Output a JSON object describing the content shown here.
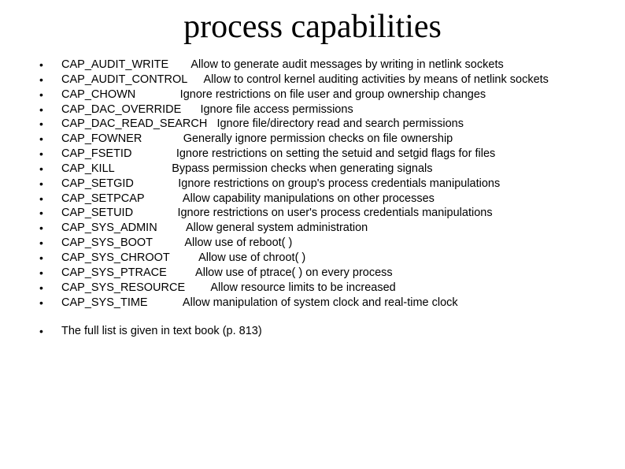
{
  "title": "process capabilities",
  "capabilities": [
    {
      "name": "CAP_AUDIT_WRITE",
      "desc": "Allow to generate audit messages by writing in netlink sockets",
      "sp": "       "
    },
    {
      "name": "CAP_AUDIT_CONTROL",
      "desc": "Allow to control kernel auditing activities by means of netlink sockets",
      "sp": "     "
    },
    {
      "name": "CAP_CHOWN",
      "desc": "Ignore restrictions on file user and group ownership changes",
      "sp": "              "
    },
    {
      "name": "CAP_DAC_OVERRIDE",
      "desc": "Ignore file access permissions",
      "sp": "      "
    },
    {
      "name": "CAP_DAC_READ_SEARCH",
      "desc": "Ignore file/directory read and search permissions",
      "sp": "   "
    },
    {
      "name": "CAP_FOWNER",
      "desc": "Generally ignore permission checks on file ownership",
      "sp": "             "
    },
    {
      "name": "CAP_FSETID",
      "desc": "Ignore restrictions on setting the setuid and setgid flags for files",
      "sp": "              "
    },
    {
      "name": "CAP_KILL",
      "desc": "Bypass permission checks when generating signals",
      "sp": "                  "
    },
    {
      "name": "CAP_SETGID",
      "desc": "Ignore restrictions on group's process credentials manipulations",
      "sp": "              "
    },
    {
      "name": "CAP_SETPCAP",
      "desc": "Allow capability manipulations on other processes",
      "sp": "            "
    },
    {
      "name": "CAP_SETUID",
      "desc": "Ignore restrictions on user's process credentials manipulations",
      "sp": "              "
    },
    {
      "name": "CAP_SYS_ADMIN",
      "desc": "Allow general system administration",
      "sp": "         "
    },
    {
      "name": "CAP_SYS_BOOT",
      "desc": "Allow use of reboot( )",
      "sp": "          "
    },
    {
      "name": "CAP_SYS_CHROOT",
      "desc": "Allow use of chroot( )",
      "sp": "         "
    },
    {
      "name": "CAP_SYS_PTRACE",
      "desc": "Allow use of ptrace( ) on every process",
      "sp": "         "
    },
    {
      "name": "CAP_SYS_RESOURCE",
      "desc": "Allow resource limits to be increased",
      "sp": "        "
    },
    {
      "name": "CAP_SYS_TIME",
      "desc": "Allow manipulation of system clock and real-time clock",
      "sp": "           "
    }
  ],
  "footer": "The full list is given in text book (p. 813)"
}
